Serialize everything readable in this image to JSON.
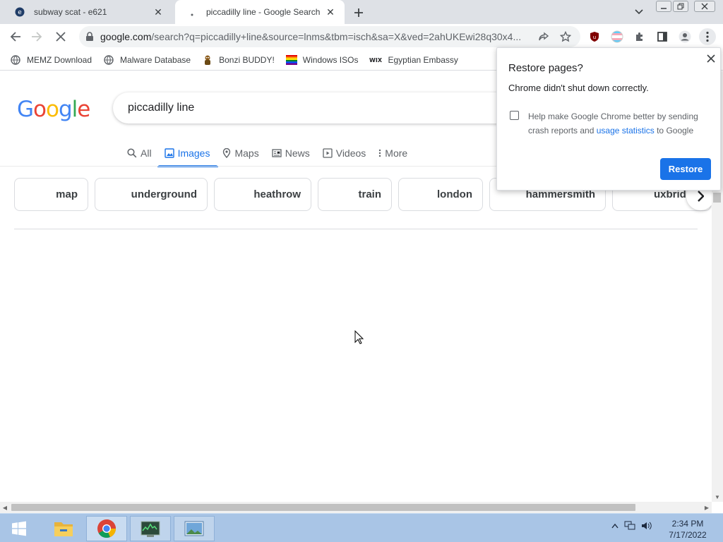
{
  "tabs": [
    {
      "title": "subway scat - e621"
    },
    {
      "title": "piccadilly line - Google Search"
    }
  ],
  "address": {
    "host": "google.com",
    "path": "/search?q=piccadilly+line&source=lnms&tbm=isch&sa=X&ved=2ahUKEwi28q30x4..."
  },
  "bookmarks": [
    {
      "label": "MEMZ Download",
      "icon": "globe-icon"
    },
    {
      "label": "Malware Database",
      "icon": "globe-icon"
    },
    {
      "label": "Bonzi BUDDY!",
      "icon": "bonzi-icon"
    },
    {
      "label": "Windows ISOs",
      "icon": "rainbow-flag-icon"
    },
    {
      "label": "Egyptian Embassy",
      "icon": "wix-icon"
    }
  ],
  "bookmark_wix_text": "WIX",
  "google": {
    "logo": [
      "G",
      "o",
      "o",
      "g",
      "l",
      "e"
    ],
    "logo_colors": [
      "#4285f4",
      "#ea4335",
      "#fbbc05",
      "#4285f4",
      "#34a853",
      "#ea4335"
    ],
    "query": "piccadilly line",
    "nav": [
      {
        "label": "All",
        "icon": "search-icon"
      },
      {
        "label": "Images",
        "icon": "image-icon",
        "active": true
      },
      {
        "label": "Maps",
        "icon": "map-pin-icon"
      },
      {
        "label": "News",
        "icon": "news-icon"
      },
      {
        "label": "Videos",
        "icon": "video-icon"
      },
      {
        "label": "More",
        "icon": "more-vertical-icon"
      }
    ],
    "chips": [
      "map",
      "underground",
      "heathrow",
      "train",
      "london",
      "hammersmith",
      "uxbridge"
    ]
  },
  "restore_popup": {
    "title": "Restore pages?",
    "message": "Chrome didn't shut down correctly.",
    "checkbox_text_before": "Help make Google Chrome better by sending crash reports and ",
    "checkbox_link": "usage statistics",
    "checkbox_text_after": " to Google",
    "button": "Restore"
  },
  "clock": {
    "time": "2:34 PM",
    "date": "7/17/2022"
  },
  "colors": {
    "accent": "#1a73e8",
    "tabstrip": "#dee1e6",
    "taskbar": "#a9c5e6"
  }
}
